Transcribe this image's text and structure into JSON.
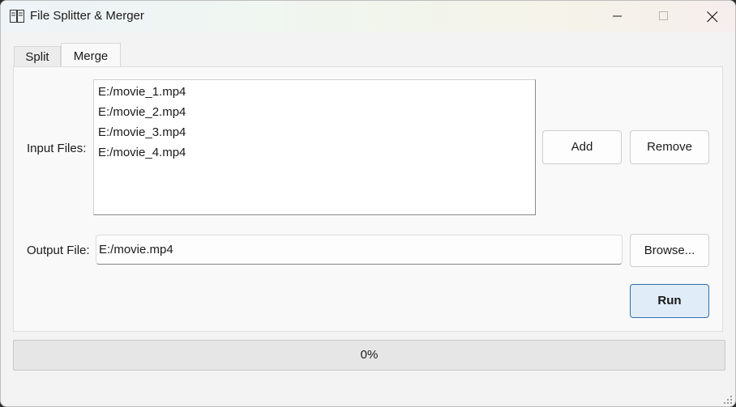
{
  "window": {
    "title": "File Splitter & Merger"
  },
  "tabs": [
    {
      "label": "Split",
      "active": false
    },
    {
      "label": "Merge",
      "active": true
    }
  ],
  "merge": {
    "input_label": "Input Files:",
    "input_files": [
      "E:/movie_1.mp4",
      "E:/movie_2.mp4",
      "E:/movie_3.mp4",
      "E:/movie_4.mp4"
    ],
    "add_label": "Add",
    "remove_label": "Remove",
    "output_label": "Output File:",
    "output_value": "E:/movie.mp4",
    "browse_label": "Browse...",
    "run_label": "Run"
  },
  "progress": {
    "value": 0,
    "text": "0%"
  },
  "colors": {
    "run_accent": "#2f6fb0",
    "progress_fill": "#3a78c3"
  },
  "icons": {
    "app": "book-icon",
    "minimize": "minimize-icon",
    "maximize": "maximize-icon",
    "close": "close-icon",
    "resize": "resize-grip-icon"
  }
}
